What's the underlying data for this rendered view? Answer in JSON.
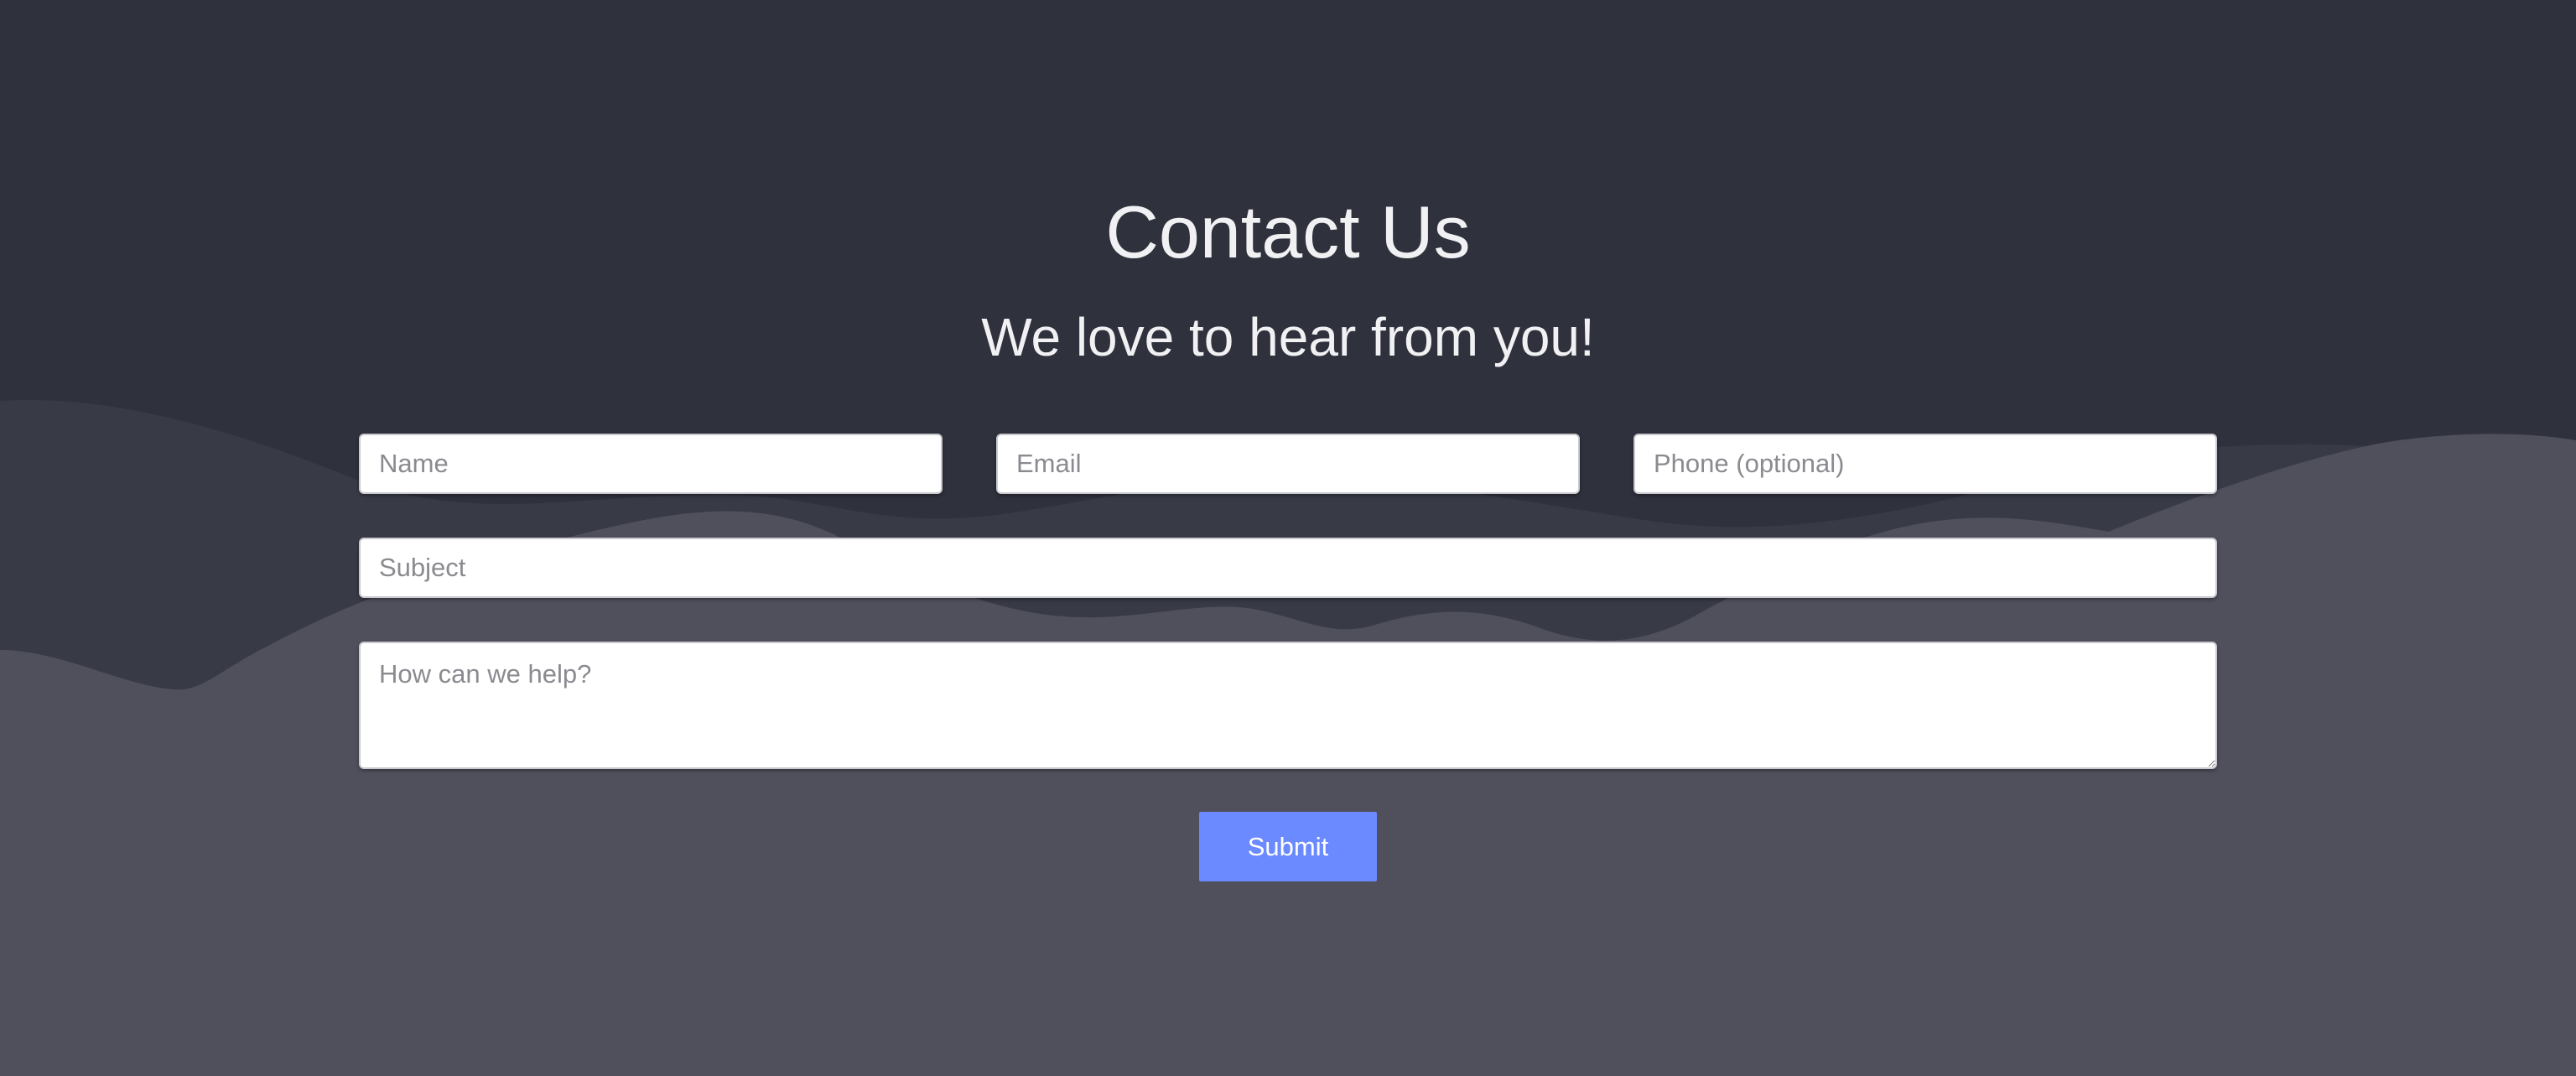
{
  "page": {
    "title": "Contact Us",
    "subtitle": "We love to hear from you!"
  },
  "form": {
    "name_placeholder": "Name",
    "name_value": "",
    "email_placeholder": "Email",
    "email_value": "",
    "phone_placeholder": "Phone (optional)",
    "phone_value": "",
    "subject_placeholder": "Subject",
    "subject_value": "",
    "message_placeholder": "How can we help?",
    "message_value": "",
    "submit_label": "Submit"
  },
  "colors": {
    "background_dark": "#2f313c",
    "wave_mid": "#383a46",
    "wave_light": "#4f505c",
    "accent": "#6b8aff",
    "text": "#f1f1f4"
  }
}
